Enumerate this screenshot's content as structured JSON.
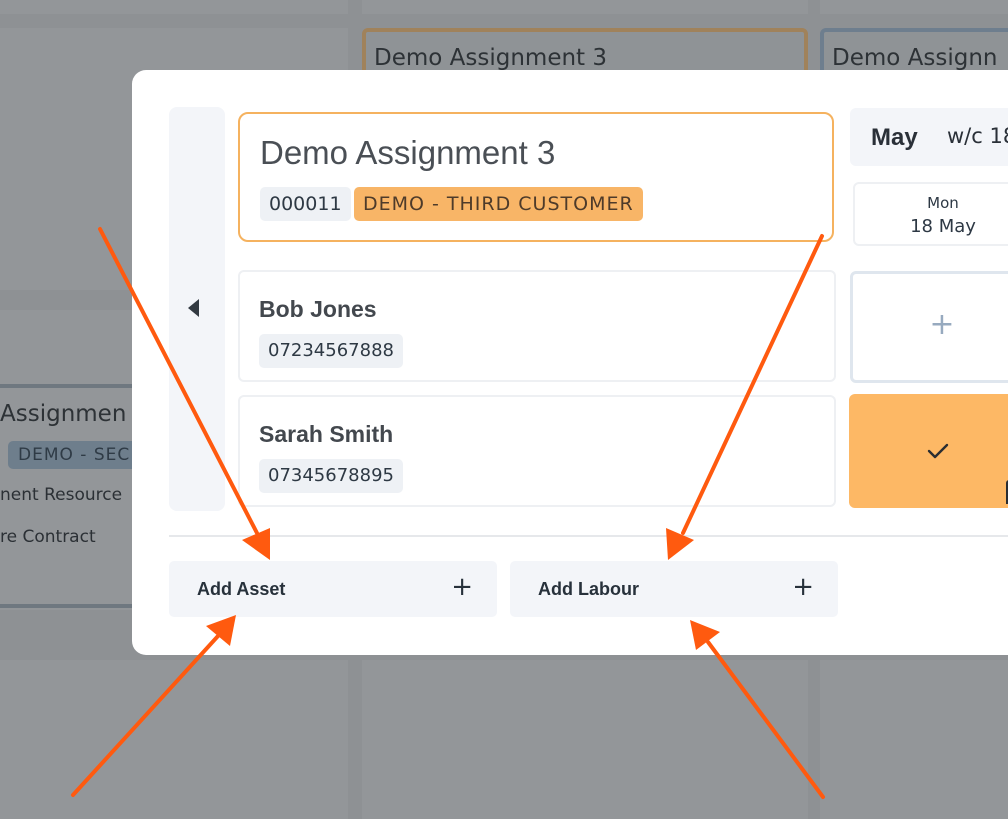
{
  "background": {
    "cards": [
      {
        "title": "Demo Assignment 3"
      },
      {
        "title": "Demo Assignn"
      },
      {
        "title": "Assignmen",
        "chip": "DEMO - SEC",
        "lines": [
          "nent Resource",
          "re Contract"
        ]
      }
    ]
  },
  "modal": {
    "assignment": {
      "title": "Demo Assignment 3",
      "id": "000011",
      "customer": "DEMO - THIRD CUSTOMER"
    },
    "people": [
      {
        "name": "Bob Jones",
        "phone": "07234567888"
      },
      {
        "name": "Sarah Smith",
        "phone": "07345678895"
      }
    ],
    "calendar": {
      "month": "May",
      "week": "w/c 18",
      "day_name": "Mon",
      "day_date": "18 May"
    },
    "actions": {
      "add_asset": "Add Asset",
      "add_labour": "Add Labour"
    }
  },
  "icons": {
    "prev": "caret-left-icon",
    "plus": "plus-icon",
    "check": "check-icon"
  },
  "colors": {
    "accent": "#f5b25f",
    "slot_filled": "#fdb865",
    "arrow": "#ff5a0f"
  }
}
